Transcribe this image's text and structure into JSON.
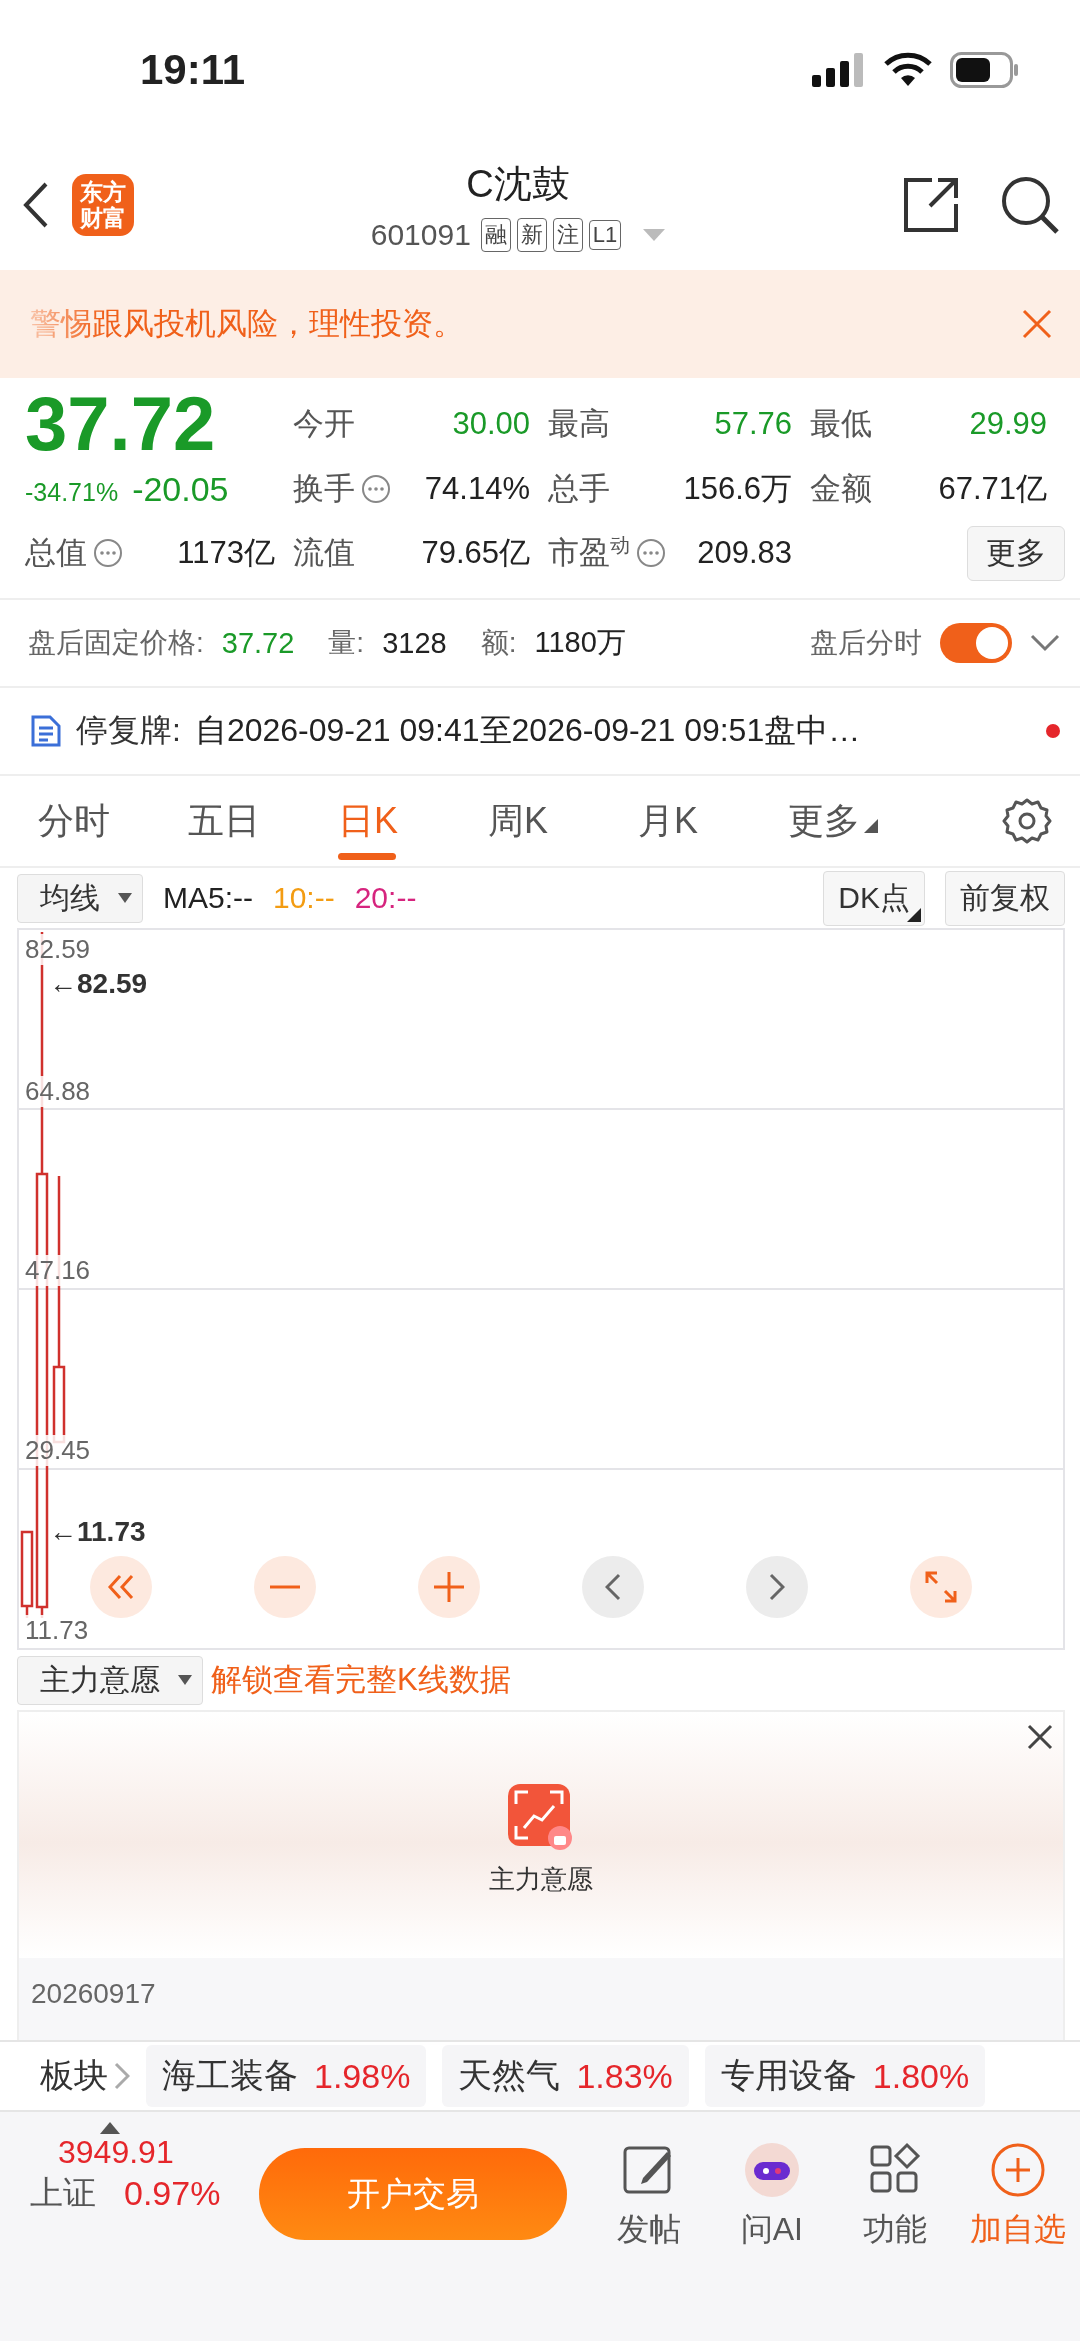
{
  "status_bar": {
    "time": "19:11"
  },
  "header": {
    "logo": "东方财富",
    "title": "C沈鼓",
    "code": "601091",
    "tags": [
      "融",
      "新",
      "注",
      "L1"
    ]
  },
  "warning": {
    "text": "警惕跟风投机风险，理性投资。"
  },
  "quote": {
    "price": "37.72",
    "change_pct": "-34.71%",
    "change": "-20.05",
    "stats": [
      {
        "label": "今开",
        "value": "30.00",
        "color": "#1a9a28",
        "info": false
      },
      {
        "label": "最高",
        "value": "57.76",
        "color": "#1a9a28",
        "info": false
      },
      {
        "label": "最低",
        "value": "29.99",
        "color": "#1a9a28",
        "info": false
      },
      {
        "label": "换手",
        "value": "74.14%",
        "color": "#222222",
        "info": true
      },
      {
        "label": "总手",
        "value": "156.6万",
        "color": "#222222",
        "info": false
      },
      {
        "label": "金额",
        "value": "67.71亿",
        "color": "#222222",
        "info": false
      },
      {
        "label": "总值",
        "value": "1173亿",
        "color": "#222222",
        "info": true
      },
      {
        "label": "流值",
        "value": "79.65亿",
        "color": "#222222",
        "info": false
      },
      {
        "label": "市盈$^{动}$",
        "value": "209.83",
        "color": "#222222",
        "info": true
      }
    ],
    "more": "更多"
  },
  "after_hours": {
    "label": "盘后固定价格:",
    "price": "37.72",
    "volume_label": "量:",
    "volume": "3128",
    "amount_label": "额:",
    "amount": "1180万",
    "toggle_label": "盘后分时",
    "toggle_on": true
  },
  "suspension": {
    "label": "停复牌:",
    "text": "自2026-09-21 09:41至2026-09-21 09:51盘中…",
    "unread": true
  },
  "tabs": [
    {
      "label": "分时",
      "selected": false,
      "kind": "plain"
    },
    {
      "label": "五日",
      "selected": false,
      "kind": "plain"
    },
    {
      "label": "日K",
      "selected": true,
      "kind": "plain"
    },
    {
      "label": "周K",
      "selected": false,
      "kind": "plain"
    },
    {
      "label": "月K",
      "selected": false,
      "kind": "plain"
    },
    {
      "label": "更多",
      "selected": false,
      "kind": "menu"
    }
  ],
  "chart_toolbar": {
    "dropdown": "均线",
    "ma": [
      {
        "text": "MA5:--",
        "color": "#222222"
      },
      {
        "text": "10:--",
        "color": "#f39c12"
      },
      {
        "text": "20:--",
        "color": "#d6247e"
      }
    ],
    "dk": "DK点",
    "adjust": "前复权"
  },
  "chart": {
    "y_labels": [
      "82.59",
      "64.88",
      "47.16",
      "29.45",
      "11.73"
    ],
    "high_marker": "←82.59",
    "low_marker": "←11.73"
  },
  "indicator": {
    "dropdown": "主力意愿",
    "unlock_link": "解锁查看完整K线数据",
    "panel_label": "主力意愿",
    "date": "20260917"
  },
  "sectors": {
    "label": "板块",
    "items": [
      {
        "name": "海工装备",
        "change": "1.98%"
      },
      {
        "name": "天然气",
        "change": "1.83%"
      },
      {
        "name": "专用设备",
        "change": "1.80%"
      }
    ]
  },
  "bottom_bar": {
    "index_value": "3949.91",
    "index_name": "上证",
    "index_change": "0.97%",
    "trade_button": "开户交易",
    "actions": [
      {
        "label": "发帖",
        "kind": "post",
        "accent": false
      },
      {
        "label": "问AI",
        "kind": "ai",
        "accent": false
      },
      {
        "label": "功能",
        "kind": "apps",
        "accent": false
      },
      {
        "label": "加自选",
        "kind": "add",
        "accent": true
      }
    ]
  }
}
